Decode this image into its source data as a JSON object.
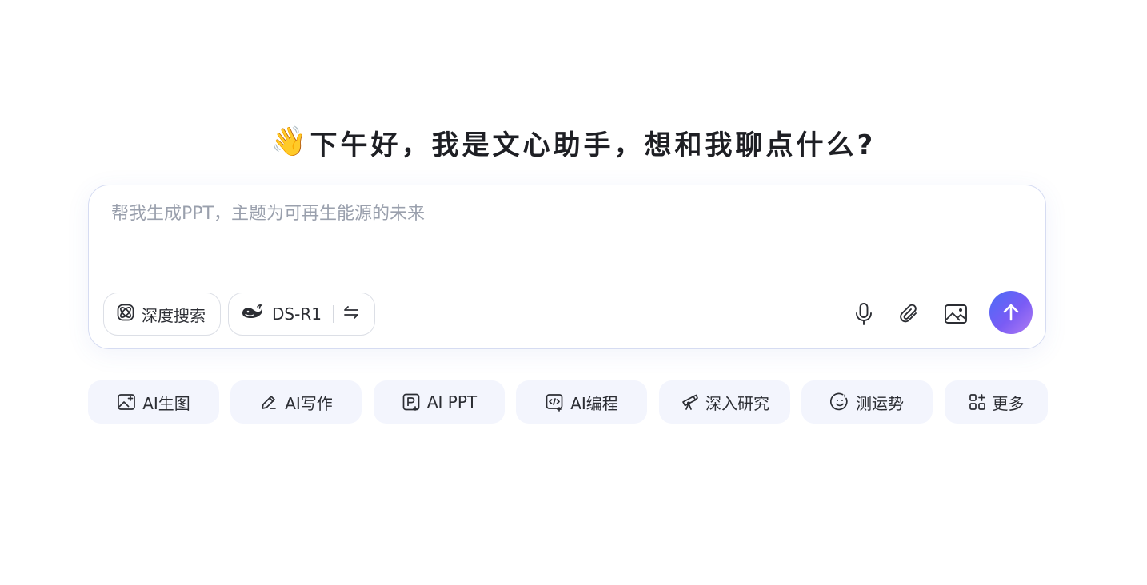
{
  "greeting": {
    "emoji": "👋",
    "text": "下午好，我是文心助手，想和我聊点什么?"
  },
  "composer": {
    "placeholder": "帮我生成PPT，主题为可再生能源的未来",
    "deep_search_label": "深度搜索",
    "model_label": "DS-R1",
    "icons": {
      "deep_search": "atom-icon",
      "model": "whale-icon",
      "switch": "swap-arrows-icon",
      "mic": "microphone-icon",
      "attach": "paperclip-icon",
      "image": "image-icon",
      "send": "arrow-up-icon"
    }
  },
  "quick_actions": [
    {
      "label": "AI生图",
      "icon": "image-plus-icon"
    },
    {
      "label": "AI写作",
      "icon": "pen-icon"
    },
    {
      "label": "AI PPT",
      "icon": "presentation-icon"
    },
    {
      "label": "AI编程",
      "icon": "code-icon"
    },
    {
      "label": "深入研究",
      "icon": "telescope-icon"
    },
    {
      "label": "测运势",
      "icon": "fortune-face-icon"
    },
    {
      "label": "更多",
      "icon": "apps-plus-icon"
    }
  ],
  "colors": {
    "accent_gradient_start": "#4a6cf7",
    "accent_gradient_end": "#b07cf2",
    "chip_background": "#f3f5fd",
    "placeholder_text": "#9aa0ad"
  }
}
